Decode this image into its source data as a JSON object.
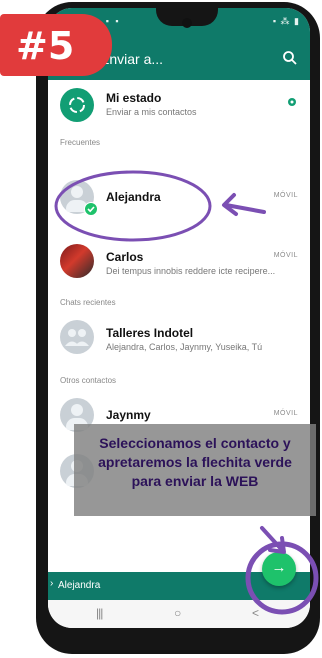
{
  "badge": {
    "text": "#5"
  },
  "status_bar": {
    "left": "◦ ▪ ▪",
    "right": "▪ ⁂ ▮"
  },
  "app_bar": {
    "title": "Enviar a...",
    "search_icon": "search-icon"
  },
  "status_row": {
    "name": "Mi estado",
    "subtitle": "Enviar a mis contactos",
    "settings_icon": "gear-icon"
  },
  "sections": {
    "frequent": "Frecuentes",
    "recent_chats": "Chats recientes",
    "other_contacts": "Otros contactos"
  },
  "contacts": [
    {
      "name": "Alejandra",
      "tag": "MÓVIL",
      "selected": true
    },
    {
      "name": "Carlos",
      "tag": "MÓVIL",
      "subtitle": "Dei tempus innobis reddere icte recipere..."
    },
    {
      "name": "Talleres Indotel",
      "subtitle": "Alejandra, Carlos, Jaynmy, Yuseika, Tú"
    },
    {
      "name": "Jaynmy",
      "tag": "MÓVIL"
    }
  ],
  "footer": {
    "selected_label": "Alejandra"
  },
  "fab": {
    "icon": "→"
  },
  "navbar": {
    "recent": "|||",
    "home": "○",
    "back": "<"
  },
  "annotation": {
    "caption": "Seleccionamos el contacto y apretaremos la flechita verde para enviar la WEB"
  },
  "colors": {
    "header": "#0f7a69",
    "fab": "#1ec26b",
    "badge": "#e13b3c",
    "annotation": "#7b4fb3"
  }
}
